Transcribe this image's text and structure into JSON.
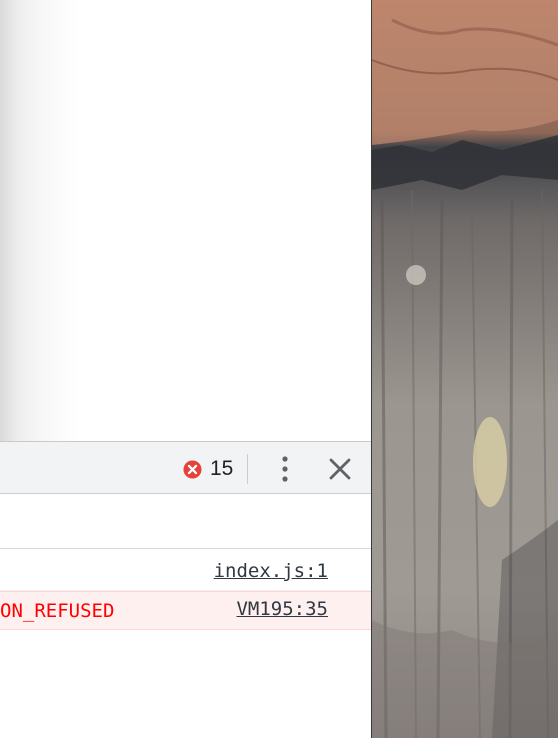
{
  "devtools": {
    "error_count": "15",
    "icons": {
      "error": "error-circle-x-icon",
      "menu": "more-vertical-icon",
      "close": "close-icon"
    },
    "console_rows": [
      {
        "message": "",
        "source": "index.js:1",
        "level": "info"
      },
      {
        "message": "ON_REFUSED",
        "source": "VM195:35",
        "level": "error"
      }
    ]
  },
  "colors": {
    "error_red": "#ff0000",
    "error_row_bg": "#fff0f0",
    "error_icon": "#e8413a",
    "toolbar_bg": "#f1f3f4"
  },
  "wallpaper": {
    "subject": "granite-cliff-wallpaper"
  }
}
